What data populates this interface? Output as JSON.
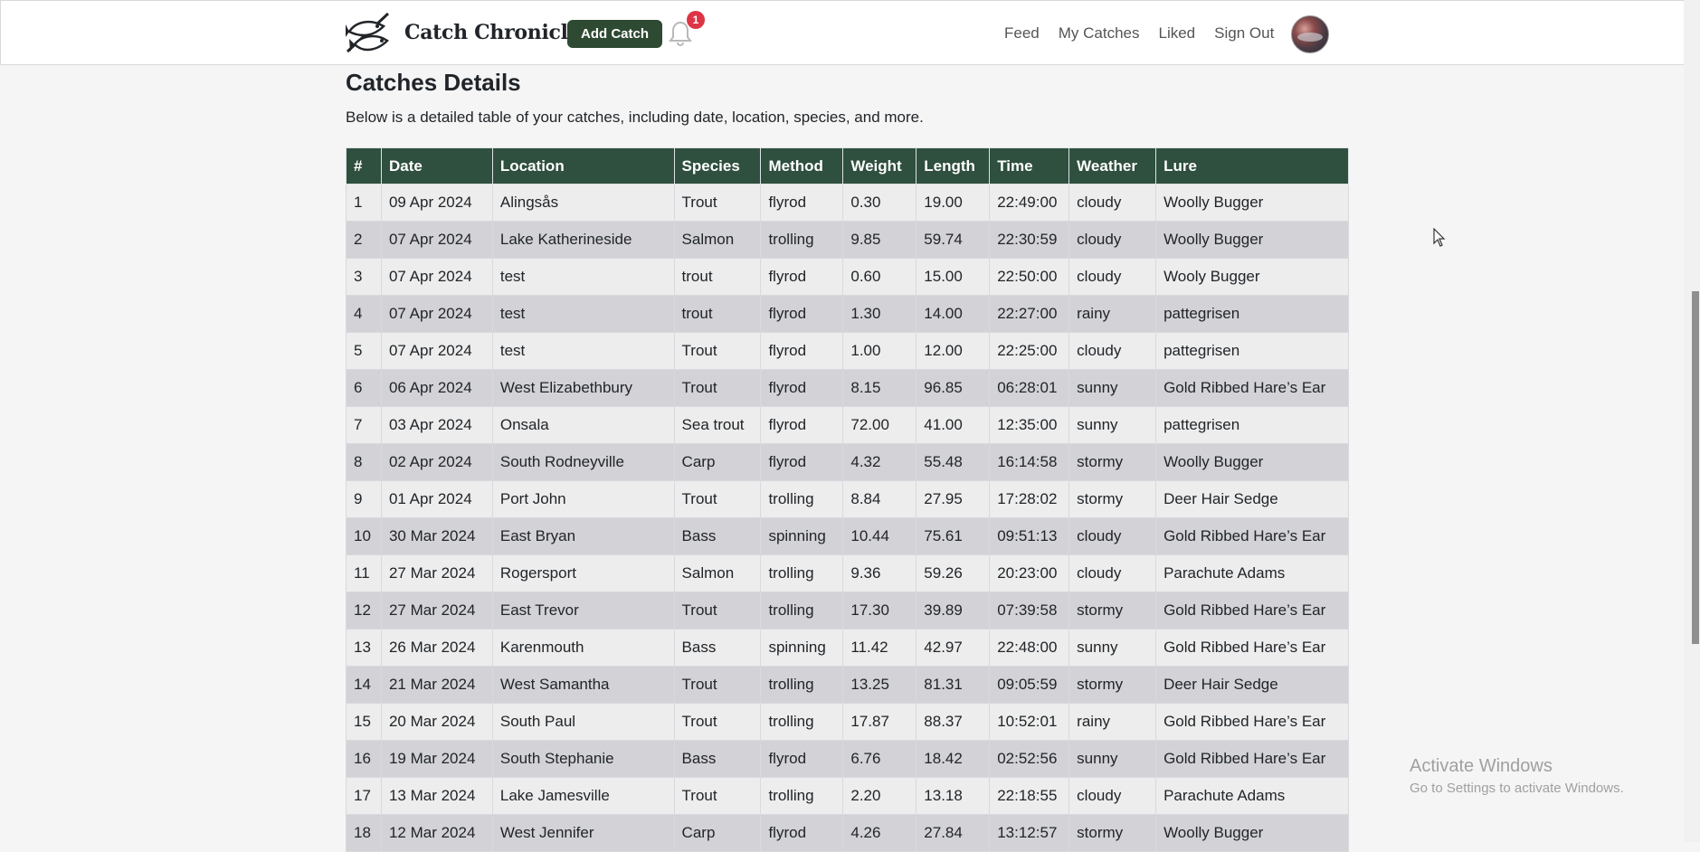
{
  "app": {
    "name": "Catch Chronicle",
    "add_catch_label": "Add Catch",
    "notification_count": "1",
    "nav": [
      {
        "label": "Feed"
      },
      {
        "label": "My Catches"
      },
      {
        "label": "Liked"
      },
      {
        "label": "Sign Out"
      }
    ]
  },
  "page": {
    "title": "Catches Details",
    "description": "Below is a detailed table of your catches, including date, location, species, and more."
  },
  "table": {
    "columns": [
      "#",
      "Date",
      "Location",
      "Species",
      "Method",
      "Weight",
      "Length",
      "Time",
      "Weather",
      "Lure"
    ],
    "rows": [
      [
        "1",
        "09 Apr 2024",
        "Alingsås",
        "Trout",
        "flyrod",
        "0.30",
        "19.00",
        "22:49:00",
        "cloudy",
        "Woolly Bugger"
      ],
      [
        "2",
        "07 Apr 2024",
        "Lake Katherineside",
        "Salmon",
        "trolling",
        "9.85",
        "59.74",
        "22:30:59",
        "cloudy",
        "Woolly Bugger"
      ],
      [
        "3",
        "07 Apr 2024",
        "test",
        "trout",
        "flyrod",
        "0.60",
        "15.00",
        "22:50:00",
        "cloudy",
        "Wooly Bugger"
      ],
      [
        "4",
        "07 Apr 2024",
        "test",
        "trout",
        "flyrod",
        "1.30",
        "14.00",
        "22:27:00",
        "rainy",
        "pattegrisen"
      ],
      [
        "5",
        "07 Apr 2024",
        "test",
        "Trout",
        "flyrod",
        "1.00",
        "12.00",
        "22:25:00",
        "cloudy",
        "pattegrisen"
      ],
      [
        "6",
        "06 Apr 2024",
        "West Elizabethbury",
        "Trout",
        "flyrod",
        "8.15",
        "96.85",
        "06:28:01",
        "sunny",
        "Gold Ribbed Hare’s Ear"
      ],
      [
        "7",
        "03 Apr 2024",
        "Onsala",
        "Sea trout",
        "flyrod",
        "72.00",
        "41.00",
        "12:35:00",
        "sunny",
        "pattegrisen"
      ],
      [
        "8",
        "02 Apr 2024",
        "South Rodneyville",
        "Carp",
        "flyrod",
        "4.32",
        "55.48",
        "16:14:58",
        "stormy",
        "Woolly Bugger"
      ],
      [
        "9",
        "01 Apr 2024",
        "Port John",
        "Trout",
        "trolling",
        "8.84",
        "27.95",
        "17:28:02",
        "stormy",
        "Deer Hair Sedge"
      ],
      [
        "10",
        "30 Mar 2024",
        "East Bryan",
        "Bass",
        "spinning",
        "10.44",
        "75.61",
        "09:51:13",
        "cloudy",
        "Gold Ribbed Hare’s Ear"
      ],
      [
        "11",
        "27 Mar 2024",
        "Rogersport",
        "Salmon",
        "trolling",
        "9.36",
        "59.26",
        "20:23:00",
        "cloudy",
        "Parachute Adams"
      ],
      [
        "12",
        "27 Mar 2024",
        "East Trevor",
        "Trout",
        "trolling",
        "17.30",
        "39.89",
        "07:39:58",
        "stormy",
        "Gold Ribbed Hare’s Ear"
      ],
      [
        "13",
        "26 Mar 2024",
        "Karenmouth",
        "Bass",
        "spinning",
        "11.42",
        "42.97",
        "22:48:00",
        "sunny",
        "Gold Ribbed Hare’s Ear"
      ],
      [
        "14",
        "21 Mar 2024",
        "West Samantha",
        "Trout",
        "trolling",
        "13.25",
        "81.31",
        "09:05:59",
        "stormy",
        "Deer Hair Sedge"
      ],
      [
        "15",
        "20 Mar 2024",
        "South Paul",
        "Trout",
        "trolling",
        "17.87",
        "88.37",
        "10:52:01",
        "rainy",
        "Gold Ribbed Hare’s Ear"
      ],
      [
        "16",
        "19 Mar 2024",
        "South Stephanie",
        "Bass",
        "flyrod",
        "6.76",
        "18.42",
        "02:52:56",
        "sunny",
        "Gold Ribbed Hare’s Ear"
      ],
      [
        "17",
        "13 Mar 2024",
        "Lake Jamesville",
        "Trout",
        "trolling",
        "2.20",
        "13.18",
        "22:18:55",
        "cloudy",
        "Parachute Adams"
      ],
      [
        "18",
        "12 Mar 2024",
        "West Jennifer",
        "Carp",
        "flyrod",
        "4.26",
        "27.84",
        "13:12:57",
        "stormy",
        "Woolly Bugger"
      ]
    ]
  },
  "watermark": {
    "title": "Activate Windows",
    "subtitle": "Go to Settings to activate Windows."
  },
  "colors": {
    "primary": "#2e4a32",
    "table_header": "#2f4f3f",
    "row_odd": "#ededed",
    "row_even": "#d2d2d7",
    "badge": "#dc3545"
  },
  "icons": {
    "logo": "fish-logo-icon",
    "notifications": "bell-icon",
    "cursor": "mouse-cursor-icon"
  }
}
